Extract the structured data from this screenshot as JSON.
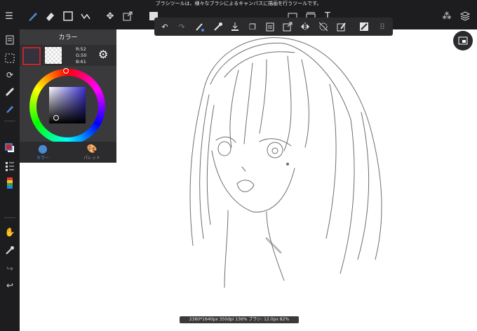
{
  "top_tip": "ブラシツールは、様々なブラシによるキャンバスに描画を行うツールです。",
  "top_toolbar": {
    "icons": [
      "menu-icon",
      "brush-icon",
      "eraser-icon",
      "shape-icon",
      "selection-pen-icon",
      "move-icon",
      "transform-icon",
      "fill-icon",
      "bucket-icon",
      "gradient-icon",
      "text-icon",
      "materials-icon",
      "layers-icon"
    ]
  },
  "float_toolbar": {
    "icons": [
      "undo-icon",
      "redo-icon",
      "lasso-fill-icon",
      "eyedropper-icon",
      "import-icon",
      "copy-icon",
      "paste-icon",
      "transform-icon",
      "flip-icon",
      "deselect-icon",
      "clear-icon",
      "snap-icon",
      "more-icon"
    ]
  },
  "left_toolbar": {
    "icons": [
      "page-icon",
      "selection-icon",
      "rotate-icon",
      "ruler-icon",
      "brush-settings-icon",
      "color-icon",
      "layer-list-icon",
      "color-bar-icon",
      "hand-icon",
      "eyedropper-icon",
      "redo-icon",
      "undo-icon"
    ]
  },
  "color_panel": {
    "title": "カラー",
    "r": "R:52",
    "g": "G:50",
    "b": "B:61",
    "foreground_color": "#34323d",
    "tabs": [
      {
        "label": "カラー",
        "active": true
      },
      {
        "label": "パレット",
        "active": false
      }
    ]
  },
  "status_bar": {
    "text": "2360*1640px 350dpi 136% ブラシ: 12.0px 82%"
  },
  "colors": {
    "toolbar_bg": "#1d1d1f",
    "panel_bg": "#3a3a3c",
    "active_tab": "#4a8bd6"
  }
}
